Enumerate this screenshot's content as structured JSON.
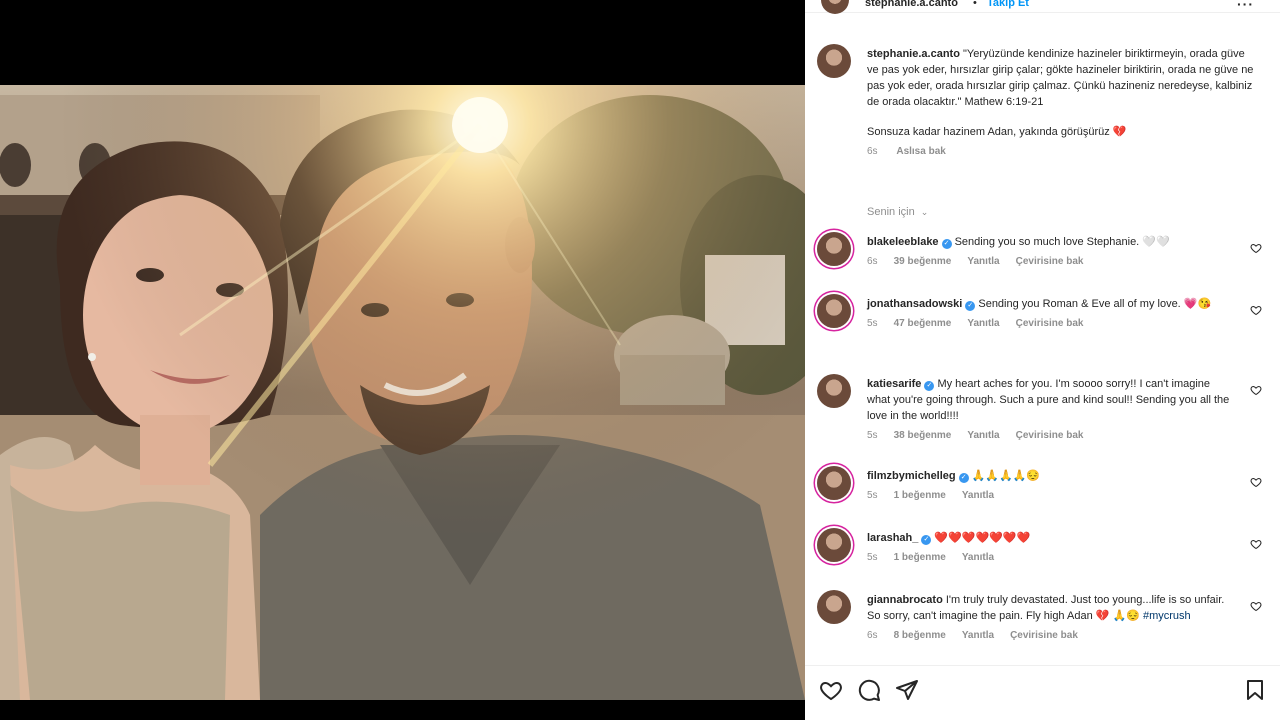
{
  "header": {
    "username": "stephanie.a.canto",
    "separator": "•",
    "follow_label": "Takip Et",
    "more_icon": "more-icon"
  },
  "caption": {
    "username": "stephanie.a.canto",
    "text": "\"Yeryüzünde kendinize hazineler biriktirmeyin, orada güve ve pas yok eder, hırsızlar girip çalar; gökte hazineler biriktirin, orada ne güve ne pas yok eder, orada hırsızlar girip çalmaz. Çünkü hazineniz neredeyse, kalbiniz de orada olacaktır.\" Mathew 6:19-21",
    "line2": "Sonsuza kadar hazinem Adan, yakında görüşürüz",
    "line2_emoji": "💔",
    "time": "6s",
    "see_translation": "Aslısa bak"
  },
  "for_you_label": "Senin için",
  "comments": [
    {
      "username": "blakeleeblake",
      "verified": true,
      "text": "Sending you so much love Stephanie. 🤍🤍",
      "time": "6s",
      "likes": "39 beğenme",
      "reply": "Yanıtla",
      "translate": "Çevirisine bak"
    },
    {
      "username": "jonathansadowski",
      "verified": true,
      "text": "Sending you Roman & Eve all of my love. 💗😘",
      "time": "5s",
      "likes": "47 beğenme",
      "reply": "Yanıtla",
      "translate": "Çevirisine bak"
    },
    {
      "username": "katiesarife",
      "verified": true,
      "text": "My heart aches for you. I'm soooo sorry!! I can't imagine what you're going through. Such a pure and kind soul!! Sending you all the love in the world!!!!",
      "time": "5s",
      "likes": "38 beğenme",
      "reply": "Yanıtla",
      "translate": "Çevirisine bak"
    },
    {
      "username": "filmzbymichelleg",
      "verified": true,
      "text": "🙏🙏🙏🙏😔",
      "time": "5s",
      "likes": "1 beğenme",
      "reply": "Yanıtla",
      "translate": ""
    },
    {
      "username": "larashah_",
      "verified": true,
      "text": "❤️❤️❤️❤️❤️❤️❤️",
      "time": "5s",
      "likes": "1 beğenme",
      "reply": "Yanıtla",
      "translate": ""
    },
    {
      "username": "giannabrocato",
      "verified": false,
      "text": "I'm truly truly devastated. Just too young...life is so unfair. So sorry, can't imagine the pain. Fly high Adan 💔 🙏😔",
      "hashtag": "#mycrush",
      "time": "6s",
      "likes": "8 beğenme",
      "reply": "Yanıtla",
      "translate": "Çevirisine bak"
    }
  ],
  "actions": {
    "like_icon": "heart-icon",
    "comment_icon": "comment-icon",
    "share_icon": "share-icon",
    "save_icon": "bookmark-icon"
  },
  "colors": {
    "verified": "#3897f0",
    "story_ring": "#d6249f",
    "follow": "#0095f6",
    "link": "#00376b"
  }
}
